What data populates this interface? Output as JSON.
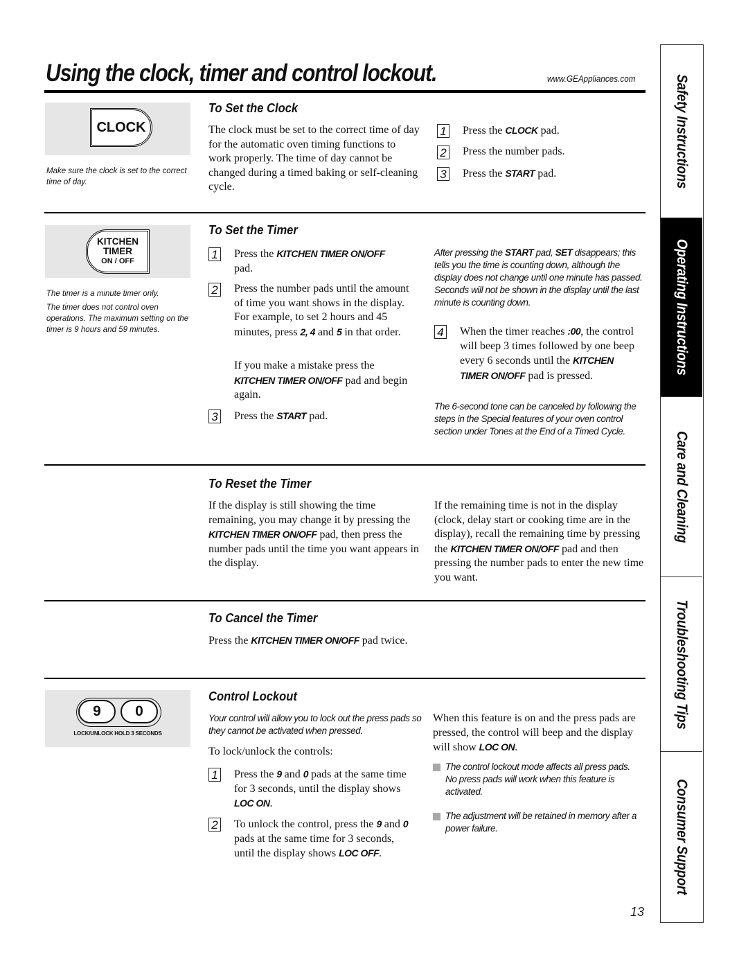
{
  "header": {
    "title": "Using the clock, timer and control lockout.",
    "url": "www.GEAppliances.com"
  },
  "side_tabs": [
    {
      "label": "Safety Instructions",
      "active": false
    },
    {
      "label": "Operating Instructions",
      "active": true
    },
    {
      "label": "Care and Cleaning",
      "active": false
    },
    {
      "label": "Troubleshooting Tips",
      "active": false
    },
    {
      "label": "Consumer Support",
      "active": false
    }
  ],
  "page_number": "13",
  "clock": {
    "pad_label": "CLOCK",
    "caption": "Make sure the clock is set to the correct time of day.",
    "heading": "To Set the Clock",
    "body": "The clock must be set to the correct time of day for the automatic oven timing functions to work properly. The time of day cannot be changed during a timed baking or self-cleaning cycle.",
    "steps": [
      {
        "num": "1",
        "pre": "Press the ",
        "bold": "CLOCK",
        "post": " pad."
      },
      {
        "num": "2",
        "pre": "Press the number pads.",
        "bold": "",
        "post": ""
      },
      {
        "num": "3",
        "pre": "Press the ",
        "bold": "START",
        "post": " pad."
      }
    ]
  },
  "timer": {
    "pad_line1": "KITCHEN",
    "pad_line2": "TIMER",
    "pad_line3": "ON / OFF",
    "caption1": "The timer is a minute timer only.",
    "caption2": "The timer does not control oven operations. The maximum setting on the timer is 9 hours and 59 minutes.",
    "heading": "To Set the Timer",
    "step1": {
      "num": "1",
      "pre": "Press the ",
      "bold": "KITCHEN TIMER ON/OFF",
      "post": " pad."
    },
    "step2": {
      "num": "2",
      "pre": "Press the number pads until the amount of time you want shows in the display. For example, to set 2 hours and 45 minutes, press ",
      "bold1": "2, 4",
      "mid": " and ",
      "bold2": "5",
      "post": " in that order."
    },
    "mistake": {
      "pre": "If you make a mistake press the ",
      "bold": "KITCHEN TIMER ON/OFF",
      "post": " pad and begin again."
    },
    "step3": {
      "num": "3",
      "pre": "Press the ",
      "bold": "START",
      "post": " pad."
    },
    "note1": {
      "pre": "After pressing the ",
      "bold1": "START",
      "mid": " pad, ",
      "bold2": "SET",
      "post": " disappears; this tells you the time is counting down, although the display does not change until one minute has passed. Seconds will not be shown in the display until the last minute is counting down."
    },
    "step4": {
      "num": "4",
      "pre": "When the timer reaches ",
      "bold1": ":00",
      "mid": ", the control will beep 3 times followed by one beep every 6 seconds until the ",
      "bold2": "KITCHEN TIMER ON/OFF",
      "post": " pad is pressed."
    },
    "note2": "The 6-second tone can be canceled by following the steps in the Special features of your oven control section under Tones at the End of a Timed Cycle."
  },
  "reset": {
    "heading": "To Reset the Timer",
    "left": {
      "pre": "If the display is still showing the time remaining, you may change it by pressing the ",
      "bold": "KITCHEN TIMER ON/OFF",
      "post": " pad, then press the number pads until the time you want appears in the display."
    },
    "right": {
      "pre": "If the remaining time is not in the display (clock, delay start or cooking time are in the display), recall the remaining time by pressing the ",
      "bold": "KITCHEN TIMER ON/OFF",
      "post": " pad and then pressing the number pads to enter the new time you want."
    }
  },
  "cancel": {
    "heading": "To Cancel the Timer",
    "body": {
      "pre": "Press the ",
      "bold": "KITCHEN TIMER ON/OFF",
      "post": " pad twice."
    }
  },
  "lockout": {
    "pad_key1": "9",
    "pad_key2": "0",
    "pad_caption": "LOCK/UNLOCK HOLD 3 SECONDS",
    "heading": "Control Lockout",
    "intro": "Your control will allow you to lock out the press pads so they cannot be activated when pressed.",
    "lead": "To lock/unlock the controls:",
    "step1": {
      "num": "1",
      "pre": "Press the ",
      "bold1": "9",
      "mid": " and ",
      "bold2": "0",
      "post1": " pads at the same time for 3 seconds, until the display shows ",
      "bold3": "LOC ON",
      "post2": "."
    },
    "step2": {
      "num": "2",
      "pre": "To unlock the control, press the ",
      "bold1": "9",
      "mid": " and ",
      "bold2": "0",
      "post1": " pads at the same time for 3 seconds, until the display shows ",
      "bold3": "LOC OFF",
      "post2": "."
    },
    "right": {
      "pre": "When this feature is on and the press pads are pressed, the control will beep and the display will show ",
      "bold": "LOC ON",
      "post": "."
    },
    "bullets": [
      "The control lockout mode affects all press pads. No press pads will work when this feature is activated.",
      "The adjustment will be retained in memory after a power failure."
    ]
  }
}
